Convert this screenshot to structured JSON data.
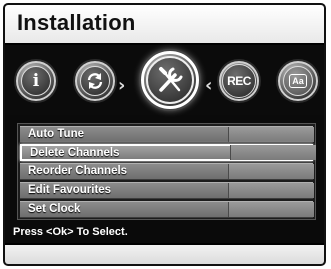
{
  "window": {
    "title": "Installation"
  },
  "icons": [
    {
      "name": "info-icon",
      "glyph": "i"
    },
    {
      "name": "refresh-icon",
      "glyph": "refresh"
    },
    {
      "name": "tools-icon",
      "glyph": "wrench-screwdriver",
      "selected": true
    },
    {
      "name": "record-icon",
      "glyph": "REC"
    },
    {
      "name": "subtitle-icon",
      "glyph": "Aa"
    }
  ],
  "nav": {
    "left_chevron": "›",
    "right_chevron": "‹"
  },
  "menu": {
    "items": [
      {
        "label": "Auto Tune"
      },
      {
        "label": "Delete Channels",
        "selected": true
      },
      {
        "label": "Reorder Channels"
      },
      {
        "label": "Edit Favourites"
      },
      {
        "label": "Set Clock"
      }
    ]
  },
  "footer": {
    "hint": "Press <Ok> To Select."
  },
  "colors": {
    "background": "#0a0a0a",
    "menu_item": "#7e7e7e",
    "selected_border": "#ffffff",
    "title_bar": "#f2f2f2"
  }
}
